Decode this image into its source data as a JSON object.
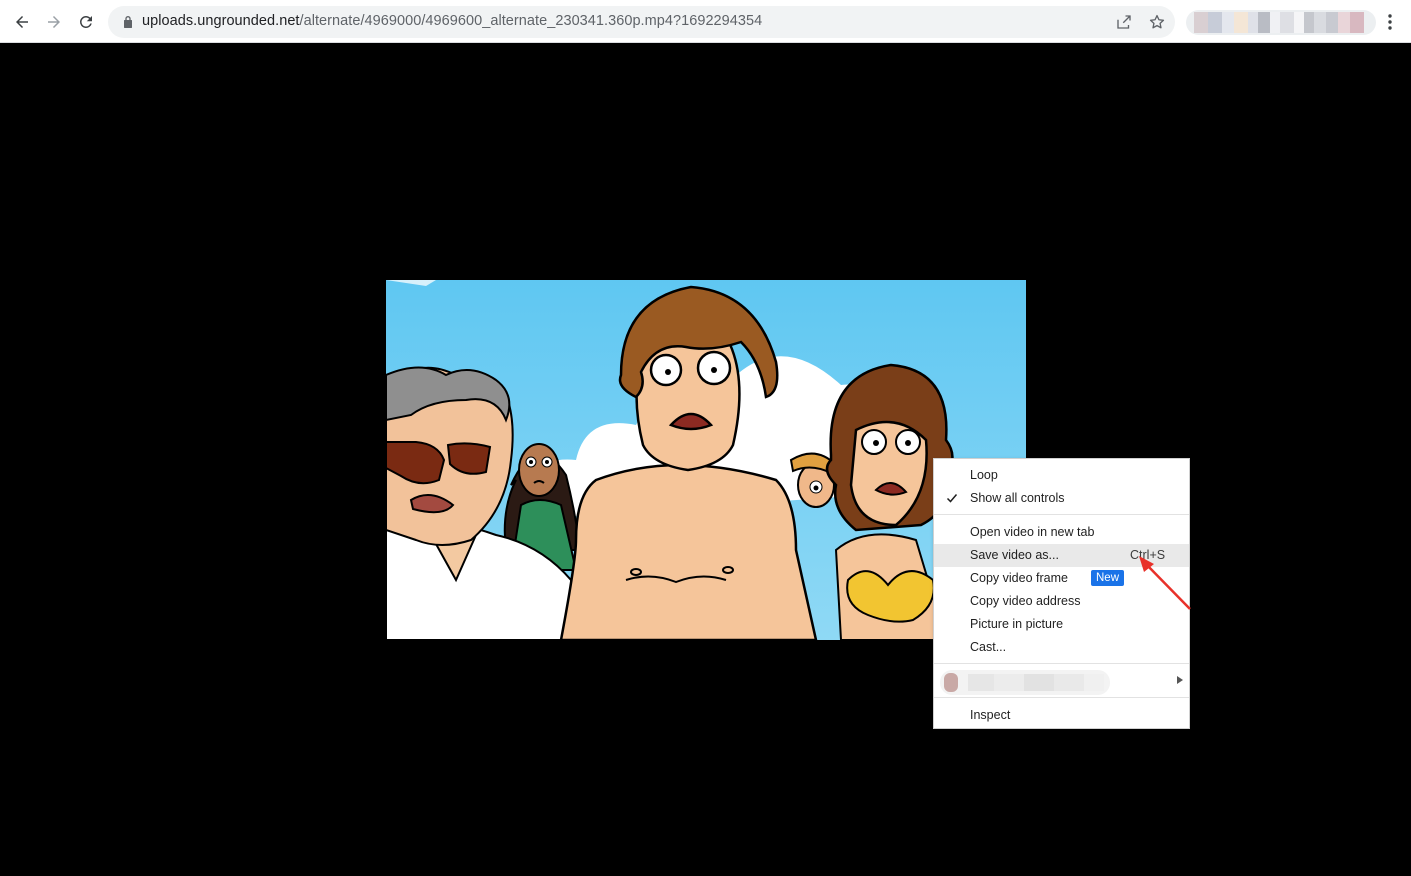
{
  "browser": {
    "url_host": "uploads.ungrounded.net",
    "url_path": "/alternate/4969000/4969600_alternate_230341.360p.mp4?1692294354",
    "icons": {
      "back": "back-arrow-icon",
      "forward": "forward-arrow-icon",
      "reload": "reload-icon",
      "lock": "lock-icon",
      "share": "share-icon",
      "bookmark": "star-icon",
      "menu": "kebab-menu-icon"
    }
  },
  "context_menu": {
    "items": [
      {
        "label": "Loop",
        "checked": false
      },
      {
        "label": "Show all controls",
        "checked": true
      },
      {
        "label": "Open video in new tab"
      },
      {
        "label": "Save video as...",
        "shortcut": "Ctrl+S",
        "highlighted": true
      },
      {
        "label": "Copy video frame",
        "badge": "New"
      },
      {
        "label": "Copy video address"
      },
      {
        "label": "Picture in picture"
      },
      {
        "label": "Cast..."
      },
      {
        "label": "Inspect"
      }
    ],
    "badge_color": "#1a73e8",
    "highlight_color": "#e9e9e9"
  },
  "annotation": {
    "color": "#e8312a",
    "points_to": "Save video as..."
  },
  "colors": {
    "page_background": "#000000",
    "toolbar_background": "#ffffff",
    "omnibox_background": "#f1f3f4"
  }
}
